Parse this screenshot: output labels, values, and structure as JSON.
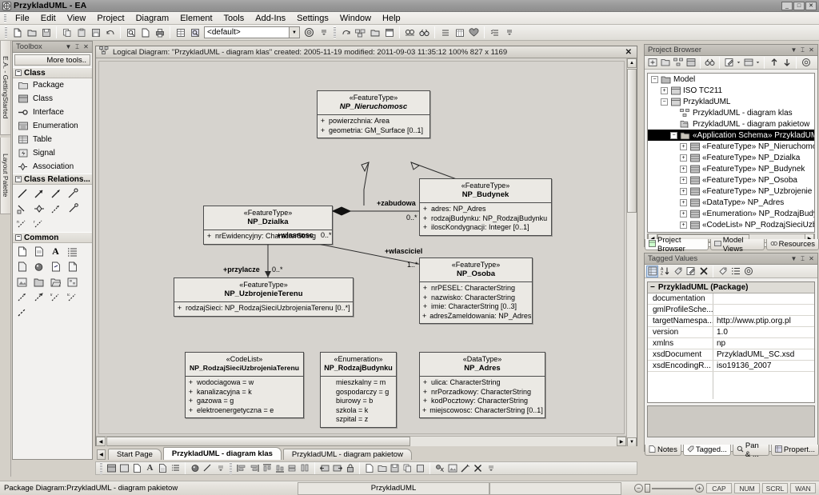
{
  "window": {
    "title": "PrzykladUML - EA",
    "app_icon": "ea-logo-icon",
    "buttons": [
      {
        "name": "minimize",
        "glyph": "_"
      },
      {
        "name": "maximize",
        "glyph": "□"
      },
      {
        "name": "close",
        "glyph": "✕"
      }
    ]
  },
  "menu": {
    "items": [
      "File",
      "Edit",
      "View",
      "Project",
      "Diagram",
      "Element",
      "Tools",
      "Add-Ins",
      "Settings",
      "Window",
      "Help"
    ]
  },
  "toolbar": {
    "combo_value": "<default>",
    "buttons": [
      "new-project-icon",
      "open-project-icon",
      "save-icon",
      "copy-icon",
      "paste-icon",
      "save-all-icon",
      "undo-icon",
      "search-icon",
      "new-diagram-icon",
      "print-icon",
      "grid-icon",
      "zoom-search-icon",
      "globe-icon",
      "redo-icon",
      "package-icon",
      "folder-open-icon",
      "window-icon",
      "find-in-project-icon",
      "binoculars-icon",
      "list-icon",
      "calendar-icon",
      "heart-icon",
      "checklist-icon"
    ]
  },
  "left_vtabs": [
    {
      "label": "E.A. - GettingStarted",
      "icon": "pencil-icon"
    },
    {
      "label": "Layout Palette",
      "icon": "layout-icon"
    }
  ],
  "toolbox": {
    "title": "Toolbox",
    "title_icons": [
      "chevron-down-icon",
      "pin-icon",
      "close-icon"
    ],
    "more_tools": "More tools..",
    "groups": [
      {
        "name": "Class",
        "items": [
          {
            "label": "Package",
            "icon": "package-icon"
          },
          {
            "label": "Class",
            "icon": "class-icon"
          },
          {
            "label": "Interface",
            "icon": "interface-icon"
          },
          {
            "label": "Enumeration",
            "icon": "enumeration-icon"
          },
          {
            "label": "Table",
            "icon": "table-icon"
          },
          {
            "label": "Signal",
            "icon": "signal-icon"
          },
          {
            "label": "Association",
            "icon": "association-icon"
          }
        ]
      },
      {
        "name": "Class Relations...",
        "icons": [
          "line-icon",
          "arrow-icon",
          "filled-arrow-icon",
          "hollow-arrow-icon",
          "note-link-icon",
          "diamond-icon",
          "dashed-arrow-icon",
          "dependency-icon",
          "dashed-rel-icon",
          "dashed-rel2-icon"
        ]
      },
      {
        "name": "Common",
        "icons": [
          "note-icon",
          "constraint-icon",
          "text-icon",
          "list-icon",
          "document-icon",
          "boundary-icon",
          "hyperlink-icon",
          "artifact-icon",
          "image-icon",
          "folder-icon",
          "open-folder-icon",
          "diagram-ref-icon",
          "anchor-icon",
          "anchor2-icon",
          "trace-icon",
          "trace2-icon",
          "dashed-line-icon"
        ]
      }
    ]
  },
  "diagram_window": {
    "icon": "diagram-icon",
    "header": "Logical Diagram: \"PrzykladUML - diagram klas\"   created: 2005-11-19  modified: 2011-09-03 11:35:12   100%   827 x 1169",
    "close_glyph": "✕",
    "classes": [
      {
        "id": "nieruchomosc",
        "stereotype": "«FeatureType»",
        "name": "NP_Nieruchomosc",
        "italic": true,
        "attributes": [
          {
            "vis": "+",
            "text": "powierzchnia:  Area"
          },
          {
            "vis": "+",
            "text": "geometria:  GM_Surface [0..1]"
          }
        ]
      },
      {
        "id": "dzialka",
        "stereotype": "«FeatureType»",
        "name": "NP_Dzialka",
        "italic": false,
        "attributes": [
          {
            "vis": "+",
            "text": "nrEwidencyjny:  CharacterString"
          }
        ]
      },
      {
        "id": "budynek",
        "stereotype": "«FeatureType»",
        "name": "NP_Budynek",
        "italic": false,
        "attributes": [
          {
            "vis": "+",
            "text": "adres:  NP_Adres"
          },
          {
            "vis": "+",
            "text": "rodzajBudynku:  NP_RodzajBudynku"
          },
          {
            "vis": "+",
            "text": "iloscKondygnacji:  Integer [0..1]"
          }
        ]
      },
      {
        "id": "osoba",
        "stereotype": "«FeatureType»",
        "name": "NP_Osoba",
        "italic": false,
        "attributes": [
          {
            "vis": "+",
            "text": "nrPESEL:  CharacterString"
          },
          {
            "vis": "+",
            "text": "nazwisko:  CharacterString"
          },
          {
            "vis": "+",
            "text": "imie:  CharacterString [0..3]"
          },
          {
            "vis": "+",
            "text": "adresZameldowania:  NP_Adres"
          }
        ]
      },
      {
        "id": "uzbrojenie",
        "stereotype": "«FeatureType»",
        "name": "NP_UzbrojenieTerenu",
        "italic": false,
        "attributes": [
          {
            "vis": "+",
            "text": "rodzajSieci:  NP_RodzajSieciUzbrojeniaTerenu [0..*]"
          }
        ]
      },
      {
        "id": "codelist",
        "stereotype": "«CodeList»",
        "name": "NP_RodzajSieciUzbrojeniaTerenu",
        "italic": false,
        "attributes": [
          {
            "vis": "+",
            "text": "wodociagowa = w"
          },
          {
            "vis": "+",
            "text": "kanalizacyjna = k"
          },
          {
            "vis": "+",
            "text": "gazowa = g"
          },
          {
            "vis": "+",
            "text": "elektroenergetyczna = e"
          }
        ]
      },
      {
        "id": "enumeration",
        "stereotype": "«Enumeration»",
        "name": "NP_RodzajBudynku",
        "italic": false,
        "attributes": [
          {
            "vis": "",
            "text": "mieszkalny = m"
          },
          {
            "vis": "",
            "text": "gospodarczy = g"
          },
          {
            "vis": "",
            "text": "biurowy = b"
          },
          {
            "vis": "",
            "text": "szkola = k"
          },
          {
            "vis": "",
            "text": "szpital = z"
          }
        ]
      },
      {
        "id": "adres",
        "stereotype": "«DataType»",
        "name": "NP_Adres",
        "italic": false,
        "attributes": [
          {
            "vis": "+",
            "text": "ulica:  CharacterString"
          },
          {
            "vis": "+",
            "text": "nrPorzadkowy:  CharacterString"
          },
          {
            "vis": "+",
            "text": "kodPocztowy:  CharacterString"
          },
          {
            "vis": "+",
            "text": "miejscowosc:  CharacterString [0..1]"
          }
        ]
      }
    ],
    "edge_labels": [
      {
        "role": "+zabudowa",
        "mult": "0..*"
      },
      {
        "role": "+wlasciciel",
        "mult": "1..*"
      },
      {
        "role": "+wlasnosc",
        "mult": "0..*"
      },
      {
        "role": "+przylacze",
        "mult": "0..*"
      }
    ]
  },
  "diagram_tabs": [
    {
      "label": "Start Page",
      "active": false
    },
    {
      "label": "PrzykladUML - diagram klas",
      "active": true
    },
    {
      "label": "PrzykladUML - diagram pakietow",
      "active": false
    }
  ],
  "diagram_toolbar": {
    "buttons": [
      "class-icon",
      "note-icon",
      "text-icon",
      "bold-a-icon",
      "document-icon",
      "list-icon",
      "boundary-icon",
      "line-icon",
      "align-left-icon",
      "align-right-icon",
      "align-top-icon",
      "align-bottom-icon",
      "same-width-icon",
      "same-height-icon",
      "undo-layout-icon",
      "redo-layout-icon",
      "lock-icon",
      "new-icon",
      "open-icon",
      "save-icon",
      "copy-icon",
      "paste-icon",
      "zorder-icon",
      "image-icon",
      "wand-icon",
      "delete-icon"
    ]
  },
  "project_browser": {
    "title": "Project Browser",
    "title_icons": [
      "chevron-down-icon",
      "pin-icon",
      "close-icon"
    ],
    "toolbar_icons": [
      "new-model-icon",
      "new-package-icon",
      "new-diagram-icon",
      "new-element-icon",
      "search-icon",
      "edit-icon",
      "chevron-down-icon",
      "view-icon",
      "chevron-down-icon",
      "move-up-icon",
      "move-down-icon",
      "options-icon"
    ],
    "tree": [
      {
        "depth": 0,
        "label": "Model",
        "pm": "-",
        "icon": "model-icon",
        "selected": false
      },
      {
        "depth": 1,
        "label": "ISO TC211",
        "pm": "+",
        "icon": "package-icon",
        "selected": false
      },
      {
        "depth": 1,
        "label": "PrzykladUML",
        "pm": "-",
        "icon": "package-icon",
        "selected": false
      },
      {
        "depth": 2,
        "label": "PrzykladUML - diagram klas",
        "pm": "",
        "icon": "class-diagram-icon",
        "selected": false
      },
      {
        "depth": 2,
        "label": "PrzykladUML - diagram pakietow",
        "pm": "",
        "icon": "package-diagram-icon",
        "selected": false
      },
      {
        "depth": 2,
        "label": "«Application Schema» PrzykladUML",
        "pm": "-",
        "icon": "folder-icon",
        "selected": true
      },
      {
        "depth": 3,
        "label": "«FeatureType» NP_Nieruchomo",
        "pm": "+",
        "icon": "class-icon",
        "selected": false
      },
      {
        "depth": 3,
        "label": "«FeatureType» NP_Dzialka",
        "pm": "+",
        "icon": "class-icon",
        "selected": false
      },
      {
        "depth": 3,
        "label": "«FeatureType» NP_Budynek",
        "pm": "+",
        "icon": "class-icon",
        "selected": false
      },
      {
        "depth": 3,
        "label": "«FeatureType» NP_Osoba",
        "pm": "+",
        "icon": "class-icon",
        "selected": false
      },
      {
        "depth": 3,
        "label": "«FeatureType» NP_Uzbrojenie",
        "pm": "+",
        "icon": "class-icon",
        "selected": false
      },
      {
        "depth": 3,
        "label": "«DataType» NP_Adres",
        "pm": "+",
        "icon": "class-icon",
        "selected": false
      },
      {
        "depth": 3,
        "label": "«Enumeration» NP_RodzajBudy",
        "pm": "+",
        "icon": "class-icon",
        "selected": false
      },
      {
        "depth": 3,
        "label": "«CodeList» NP_RodzajSieciUzb",
        "pm": "+",
        "icon": "class-icon",
        "selected": false
      }
    ],
    "tabs": [
      {
        "label": "Project Browser",
        "icon": "browser-icon",
        "active": true
      },
      {
        "label": "Model Views",
        "icon": "views-icon",
        "active": false
      },
      {
        "label": "Resources",
        "icon": "resources-icon",
        "active": false
      }
    ]
  },
  "tagged_values": {
    "title": "Tagged Values",
    "title_icons": [
      "chevron-down-icon",
      "pin-icon",
      "close-icon"
    ],
    "toolbar_icons": [
      "sort-group-icon",
      "sort-az-icon",
      "add-tag-icon",
      "edit-tag-icon",
      "delete-tag-icon",
      "tag-icon",
      "list-icon",
      "options-icon"
    ],
    "group_header": "PrzykladUML (Package)",
    "rows": [
      {
        "name": "documentation",
        "value": ""
      },
      {
        "name": "gmlProfileSche...",
        "value": ""
      },
      {
        "name": "targetNamespa...",
        "value": "http://www.ptip.org.pl"
      },
      {
        "name": "version",
        "value": "1.0"
      },
      {
        "name": "xmlns",
        "value": "np"
      },
      {
        "name": "xsdDocument",
        "value": "PrzykladUML_SC.xsd"
      },
      {
        "name": "xsdEncodingR...",
        "value": "iso19136_2007"
      }
    ],
    "tabs": [
      {
        "label": "Notes",
        "icon": "notes-icon",
        "active": false
      },
      {
        "label": "Tagged...",
        "icon": "tag-icon",
        "active": true
      },
      {
        "label": "Pan & ...",
        "icon": "pan-icon",
        "active": false
      },
      {
        "label": "Propert...",
        "icon": "properties-icon",
        "active": false
      }
    ]
  },
  "statusbar": {
    "left": "Package Diagram:PrzykladUML - diagram pakietow",
    "center": "PrzykladUML",
    "indicators": [
      "CAP",
      "NUM",
      "SCRL",
      "WAN"
    ],
    "zoom_minus": "−",
    "zoom_plus": "+"
  }
}
